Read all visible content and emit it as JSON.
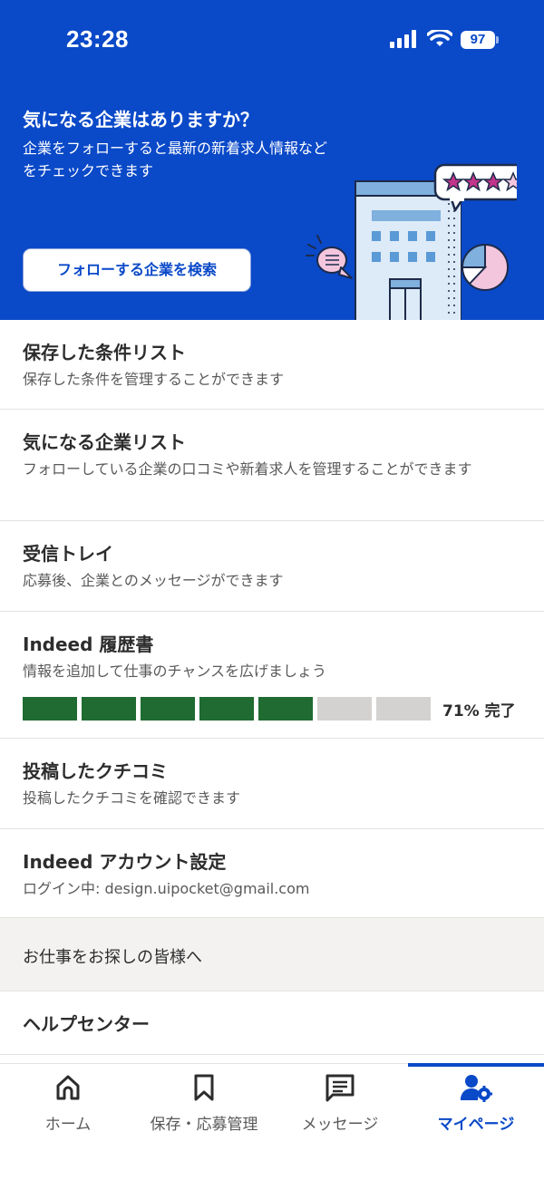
{
  "status_bar": {
    "time": "23:28",
    "battery": "97"
  },
  "hero": {
    "title": "気になる企業はありますか？",
    "description": "企業をフォローすると最新の新着求人情報などをチェックできます",
    "button_label": "フォローする企業を検索"
  },
  "menu": {
    "saved_searches": {
      "title": "保存した条件リスト",
      "subtitle": "保存した条件を管理することができます"
    },
    "followed_companies": {
      "title": "気になる企業リスト",
      "subtitle": "フォローしている企業の口コミや新着求人を管理することができます"
    },
    "inbox": {
      "title": "受信トレイ",
      "subtitle": "応募後、企業とのメッセージができます"
    },
    "resume": {
      "title": "Indeed 履歴書",
      "subtitle": "情報を追加して仕事のチャンスを広げましょう",
      "progress_percent": 71,
      "progress_label": "71% 完了",
      "segments_total": 7,
      "segments_filled": 5
    },
    "reviews": {
      "title": "投稿したクチコミ",
      "subtitle": "投稿したクチコミを確認できます"
    },
    "account": {
      "title": "Indeed アカウント設定",
      "subtitle": "ログイン中: design.uipocket@gmail.com"
    }
  },
  "section_header": "お仕事をお探しの皆様へ",
  "help_center": "ヘルプセンター",
  "tabs": [
    {
      "label": "ホーム",
      "icon": "home-icon"
    },
    {
      "label": "保存・応募管理",
      "icon": "bookmark-icon"
    },
    {
      "label": "メッセージ",
      "icon": "message-icon"
    },
    {
      "label": "マイページ",
      "icon": "profile-settings-icon",
      "active": true
    }
  ],
  "colors": {
    "brand_blue": "#0a49c8",
    "progress_filled": "#1f6b32",
    "progress_empty": "#d4d2d0"
  }
}
